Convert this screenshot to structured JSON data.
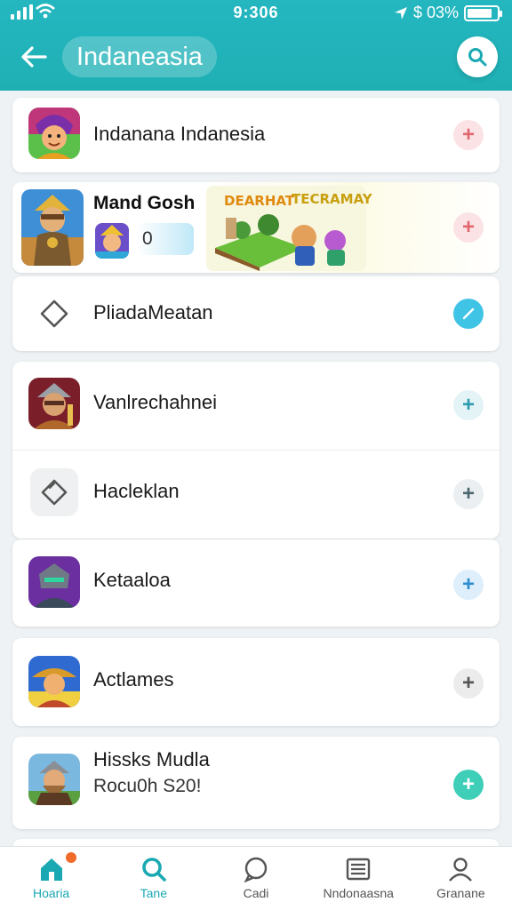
{
  "status_bar": {
    "time": "9:306",
    "right_text": "$ 03%",
    "battery_level": 0.85
  },
  "header": {
    "title": "Indaneasia",
    "back_icon": "arrow-left-icon",
    "search_icon": "search-icon"
  },
  "list": {
    "items": [
      {
        "label": "Indanana Indanesia",
        "icon": "hero-game-icon",
        "add_color": "#e0676f",
        "add_bg": "#fbe3e5"
      },
      {
        "label": "PliadaMeatan",
        "icon": "diamond-outline-icon",
        "add_color": "#ffffff",
        "add_bg": "#3fc4e6"
      },
      {
        "label": "Vanlrechahnei",
        "icon": "warrior-game-icon",
        "add_color": "#2d9bb0",
        "add_bg": "#e4f3f6"
      },
      {
        "label": "Hacleklan",
        "icon": "tag-outline-icon",
        "add_color": "#4d6770",
        "add_bg": "#eceff1"
      },
      {
        "label": "Ketaaloa",
        "icon": "knight-game-icon",
        "add_color": "#2d8fd0",
        "add_bg": "#deeefb"
      },
      {
        "label": "Actlames",
        "icon": "cowboy-game-icon",
        "add_color": "#555555",
        "add_bg": "#ececec"
      },
      {
        "label": "Hissks Mudla",
        "sub": "Rocu0h S20!",
        "icon": "dwarf-game-icon",
        "add_color": "#ffffff",
        "add_bg": "#3fcfb9"
      }
    ]
  },
  "featured": {
    "title": "Mand Gosh",
    "value": "0",
    "banner_text_1": "DEARHAT",
    "banner_text_2": "TECRAMAY",
    "add_color": "#e0676f",
    "add_bg": "#fbe3e5"
  },
  "nav": {
    "items": [
      {
        "label": "Hoaria",
        "icon": "home-icon",
        "active": true
      },
      {
        "label": "Tane",
        "icon": "search-icon",
        "active": true
      },
      {
        "label": "Cadi",
        "icon": "chat-icon",
        "active": false
      },
      {
        "label": "Nndonaasna",
        "icon": "list-icon",
        "active": false
      },
      {
        "label": "Granane",
        "icon": "profile-icon",
        "active": false
      }
    ]
  },
  "colors": {
    "header": "#1fb0b4",
    "accent": "#1aa9b3"
  }
}
